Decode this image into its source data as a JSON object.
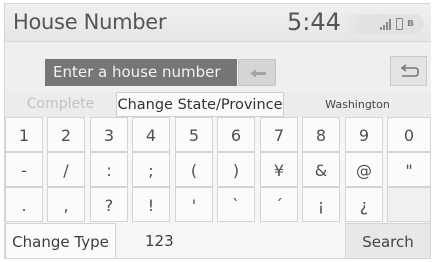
{
  "header": {
    "title": "House Number",
    "time": "5:44",
    "status_icons": [
      "signal-icon",
      "battery-icon",
      "bluetooth-icon"
    ]
  },
  "input": {
    "placeholder": "Enter a house number",
    "backspace_icon": "backspace-arrow-icon",
    "return_icon": "return-icon"
  },
  "options": {
    "complete": "Complete",
    "change_state": "Change State/Province",
    "state": "Washington"
  },
  "keyboard": {
    "rows": [
      [
        "1",
        "2",
        "3",
        "4",
        "5",
        "6",
        "7",
        "8",
        "9",
        "0"
      ],
      [
        "-",
        "/",
        ":",
        ";",
        "(",
        ")",
        "¥",
        "&",
        "@",
        "\""
      ],
      [
        ".",
        ",",
        "?",
        "!",
        "'",
        "`",
        "´",
        "¡",
        "¿"
      ]
    ]
  },
  "bottom": {
    "change_type": "Change Type",
    "mode": "123",
    "search": "Search"
  },
  "colors": {
    "input_bg": "#767676",
    "key_bg": "#fbfbfb",
    "disabled_text": "#c2c2c2"
  }
}
